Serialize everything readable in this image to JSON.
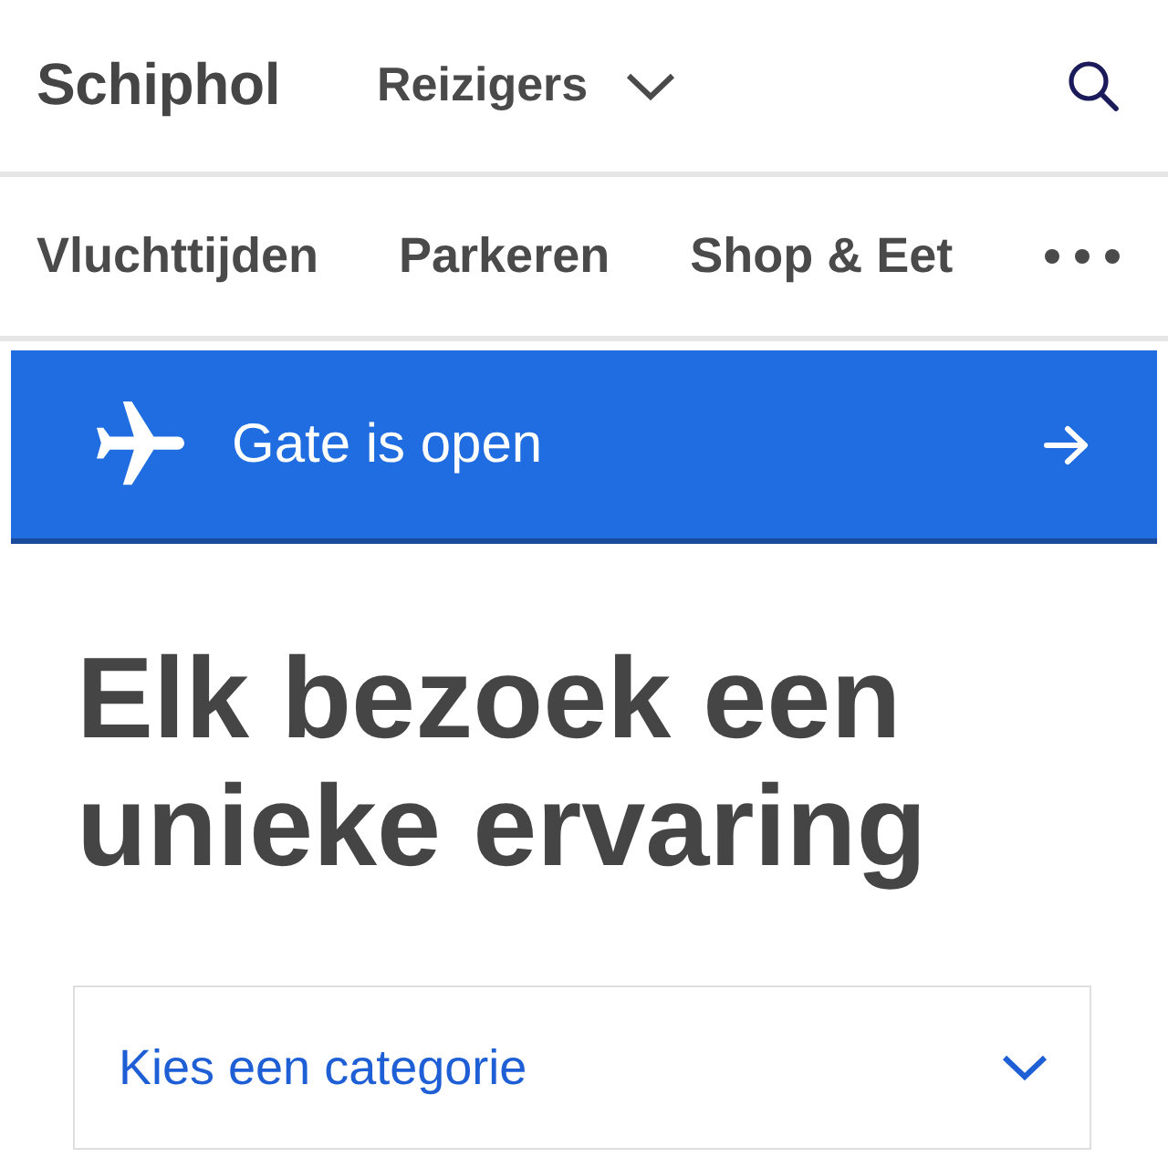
{
  "header": {
    "logo": "Schiphol",
    "audience_menu": {
      "label": "Reizigers"
    }
  },
  "nav": {
    "items": [
      "Vluchttijden",
      "Parkeren",
      "Shop & Eet"
    ]
  },
  "flight_banner": {
    "status": "Gate is open"
  },
  "hero": {
    "title": "Elk bezoek een unieke ervaring"
  },
  "category_dropdown": {
    "label": "Kies een categorie"
  }
}
